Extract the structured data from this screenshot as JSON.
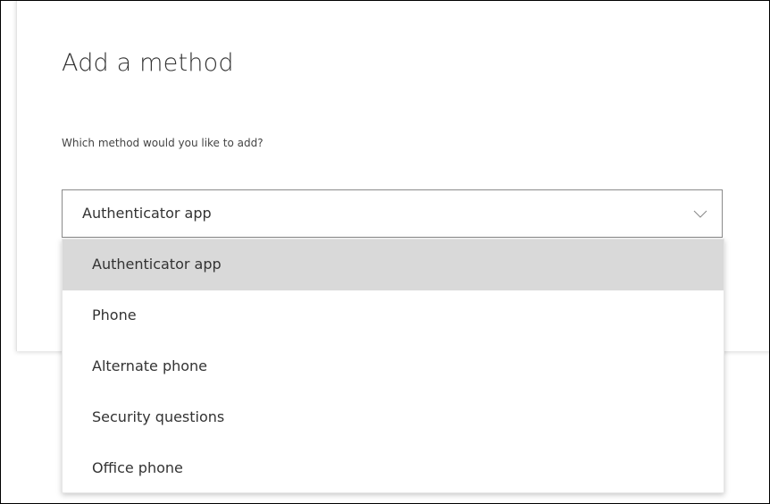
{
  "dialog": {
    "title": "Add a method",
    "question": "Which method would you like to add?"
  },
  "method_select": {
    "value": "Authenticator app",
    "icon": "chevron-down-icon",
    "options": [
      {
        "label": "Authenticator app",
        "selected": true
      },
      {
        "label": "Phone",
        "selected": false
      },
      {
        "label": "Alternate phone",
        "selected": false
      },
      {
        "label": "Security questions",
        "selected": false
      },
      {
        "label": "Office phone",
        "selected": false
      }
    ]
  },
  "colors": {
    "selected_option_bg": "#d9d9d9",
    "text": "#333333",
    "select_border": "#8a8a8a"
  }
}
